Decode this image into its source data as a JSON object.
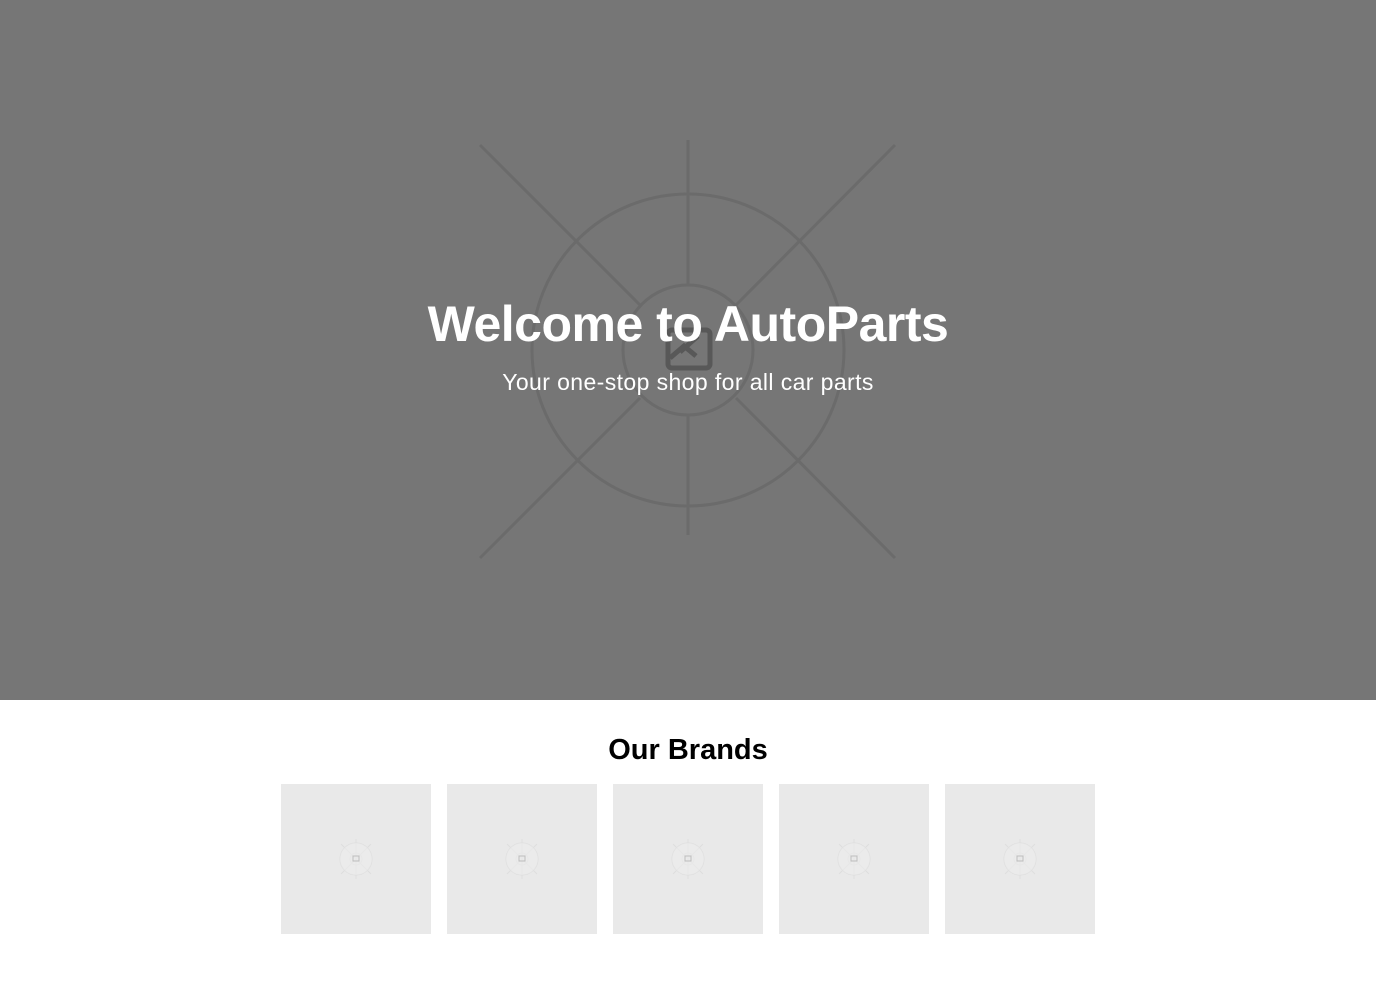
{
  "hero": {
    "title": "Welcome to AutoParts",
    "subtitle": "Your one-stop shop for all car parts",
    "image_icon": "image-placeholder-icon",
    "background_color": "#767676"
  },
  "brands": {
    "heading": "Our Brands",
    "tile_color": "#e9e9e9",
    "logos": [
      {
        "icon": "image-placeholder-icon"
      },
      {
        "icon": "image-placeholder-icon"
      },
      {
        "icon": "image-placeholder-icon"
      },
      {
        "icon": "image-placeholder-icon"
      },
      {
        "icon": "image-placeholder-icon"
      }
    ]
  }
}
